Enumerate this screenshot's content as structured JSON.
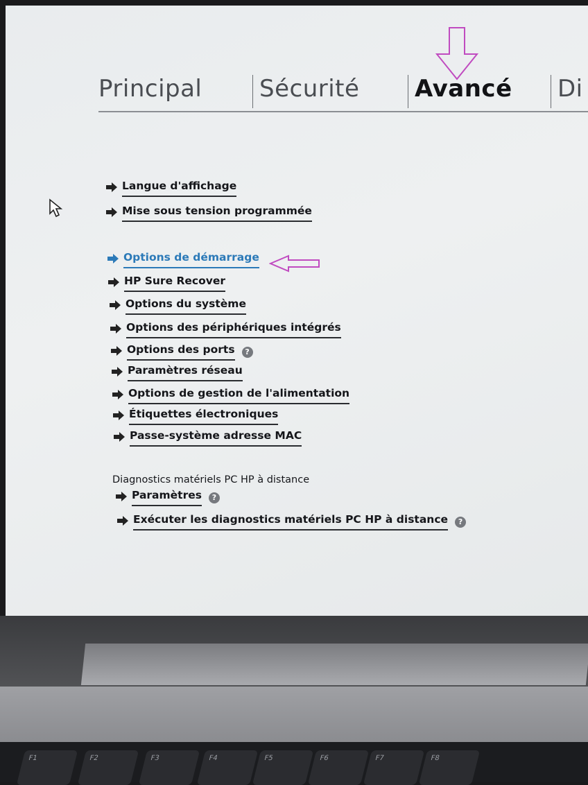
{
  "tabs": [
    {
      "label": "Principal",
      "active": false
    },
    {
      "label": "Sécurité",
      "active": false
    },
    {
      "label": "Avancé",
      "active": true
    },
    {
      "label": "Di",
      "active": false
    }
  ],
  "menu": {
    "group1": [
      "Langue d'affichage",
      "Mise sous tension programmée"
    ],
    "group2": [
      "Options de démarrage",
      "HP Sure Recover",
      "Options du système",
      "Options des périphériques intégrés",
      "Options des ports",
      "Paramètres réseau",
      "Options de gestion de l'alimentation",
      "Étiquettes électroniques",
      "Passe-système adresse MAC"
    ],
    "selected": "Options de démarrage",
    "diagnostics_heading": "Diagnostics matériels PC HP à distance",
    "diagnostics_items": [
      "Paramètres",
      "Exécuter les diagnostics matériels PC HP à distance"
    ]
  },
  "icons": {
    "arrow": "arrow-right-icon",
    "help": "question-mark-icon",
    "help_glyph": "?",
    "cursor": "mouse-pointer-icon"
  },
  "keyboard": [
    "F1",
    "F2",
    "F3",
    "F4",
    "F5",
    "F6",
    "F7",
    "F8"
  ],
  "colors": {
    "selected": "#2c7ab8",
    "text": "#15161a",
    "annotation": "#c04bc0"
  }
}
